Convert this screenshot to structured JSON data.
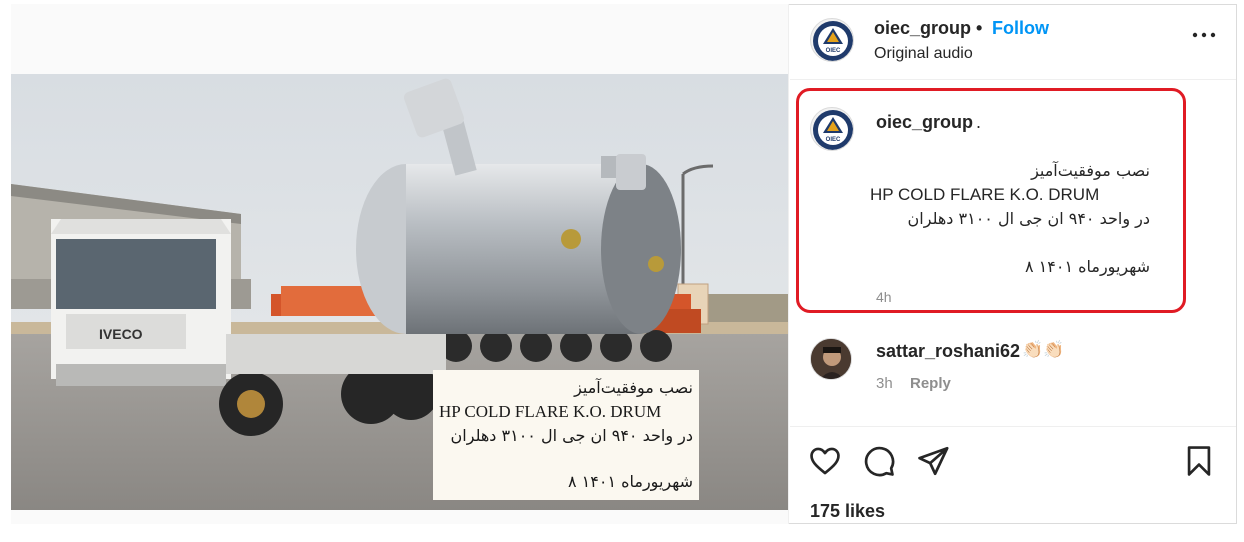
{
  "post": {
    "author": "oiec_group",
    "follow_label": "Follow",
    "audio": "Original audio",
    "likes": "175 likes"
  },
  "media": {
    "overlay_line1": "نصب موفقیت‌آمیز",
    "overlay_line2": "HP COLD FLARE K.O. DRUM",
    "overlay_line3": "در واحد ۹۴۰ ان جی ال ۳۱۰۰ دهلران",
    "overlay_line4": "شهریورماه ۱۴۰۱ ۸",
    "truck_brand": "IVECO"
  },
  "comments": [
    {
      "username": "oiec_group",
      "suffix": ".",
      "line1": "نصب موفقیت‌آمیز",
      "line2": "HP COLD FLARE K.O. DRUM",
      "line3": "در واحد ۹۴۰ ان جی ال ۳۱۰۰ دهلران",
      "line4": "شهریورماه ۱۴۰۱ ۸",
      "time": "4h"
    },
    {
      "username": "sattar_roshani62",
      "emoji": "👏🏻👏🏻",
      "time": "3h",
      "reply_label": "Reply"
    }
  ],
  "avatar_text": "OIEC",
  "colors": {
    "follow": "#0095f6",
    "highlight_border": "#e01b24",
    "muted": "#8e8e8e",
    "text": "#262626"
  }
}
